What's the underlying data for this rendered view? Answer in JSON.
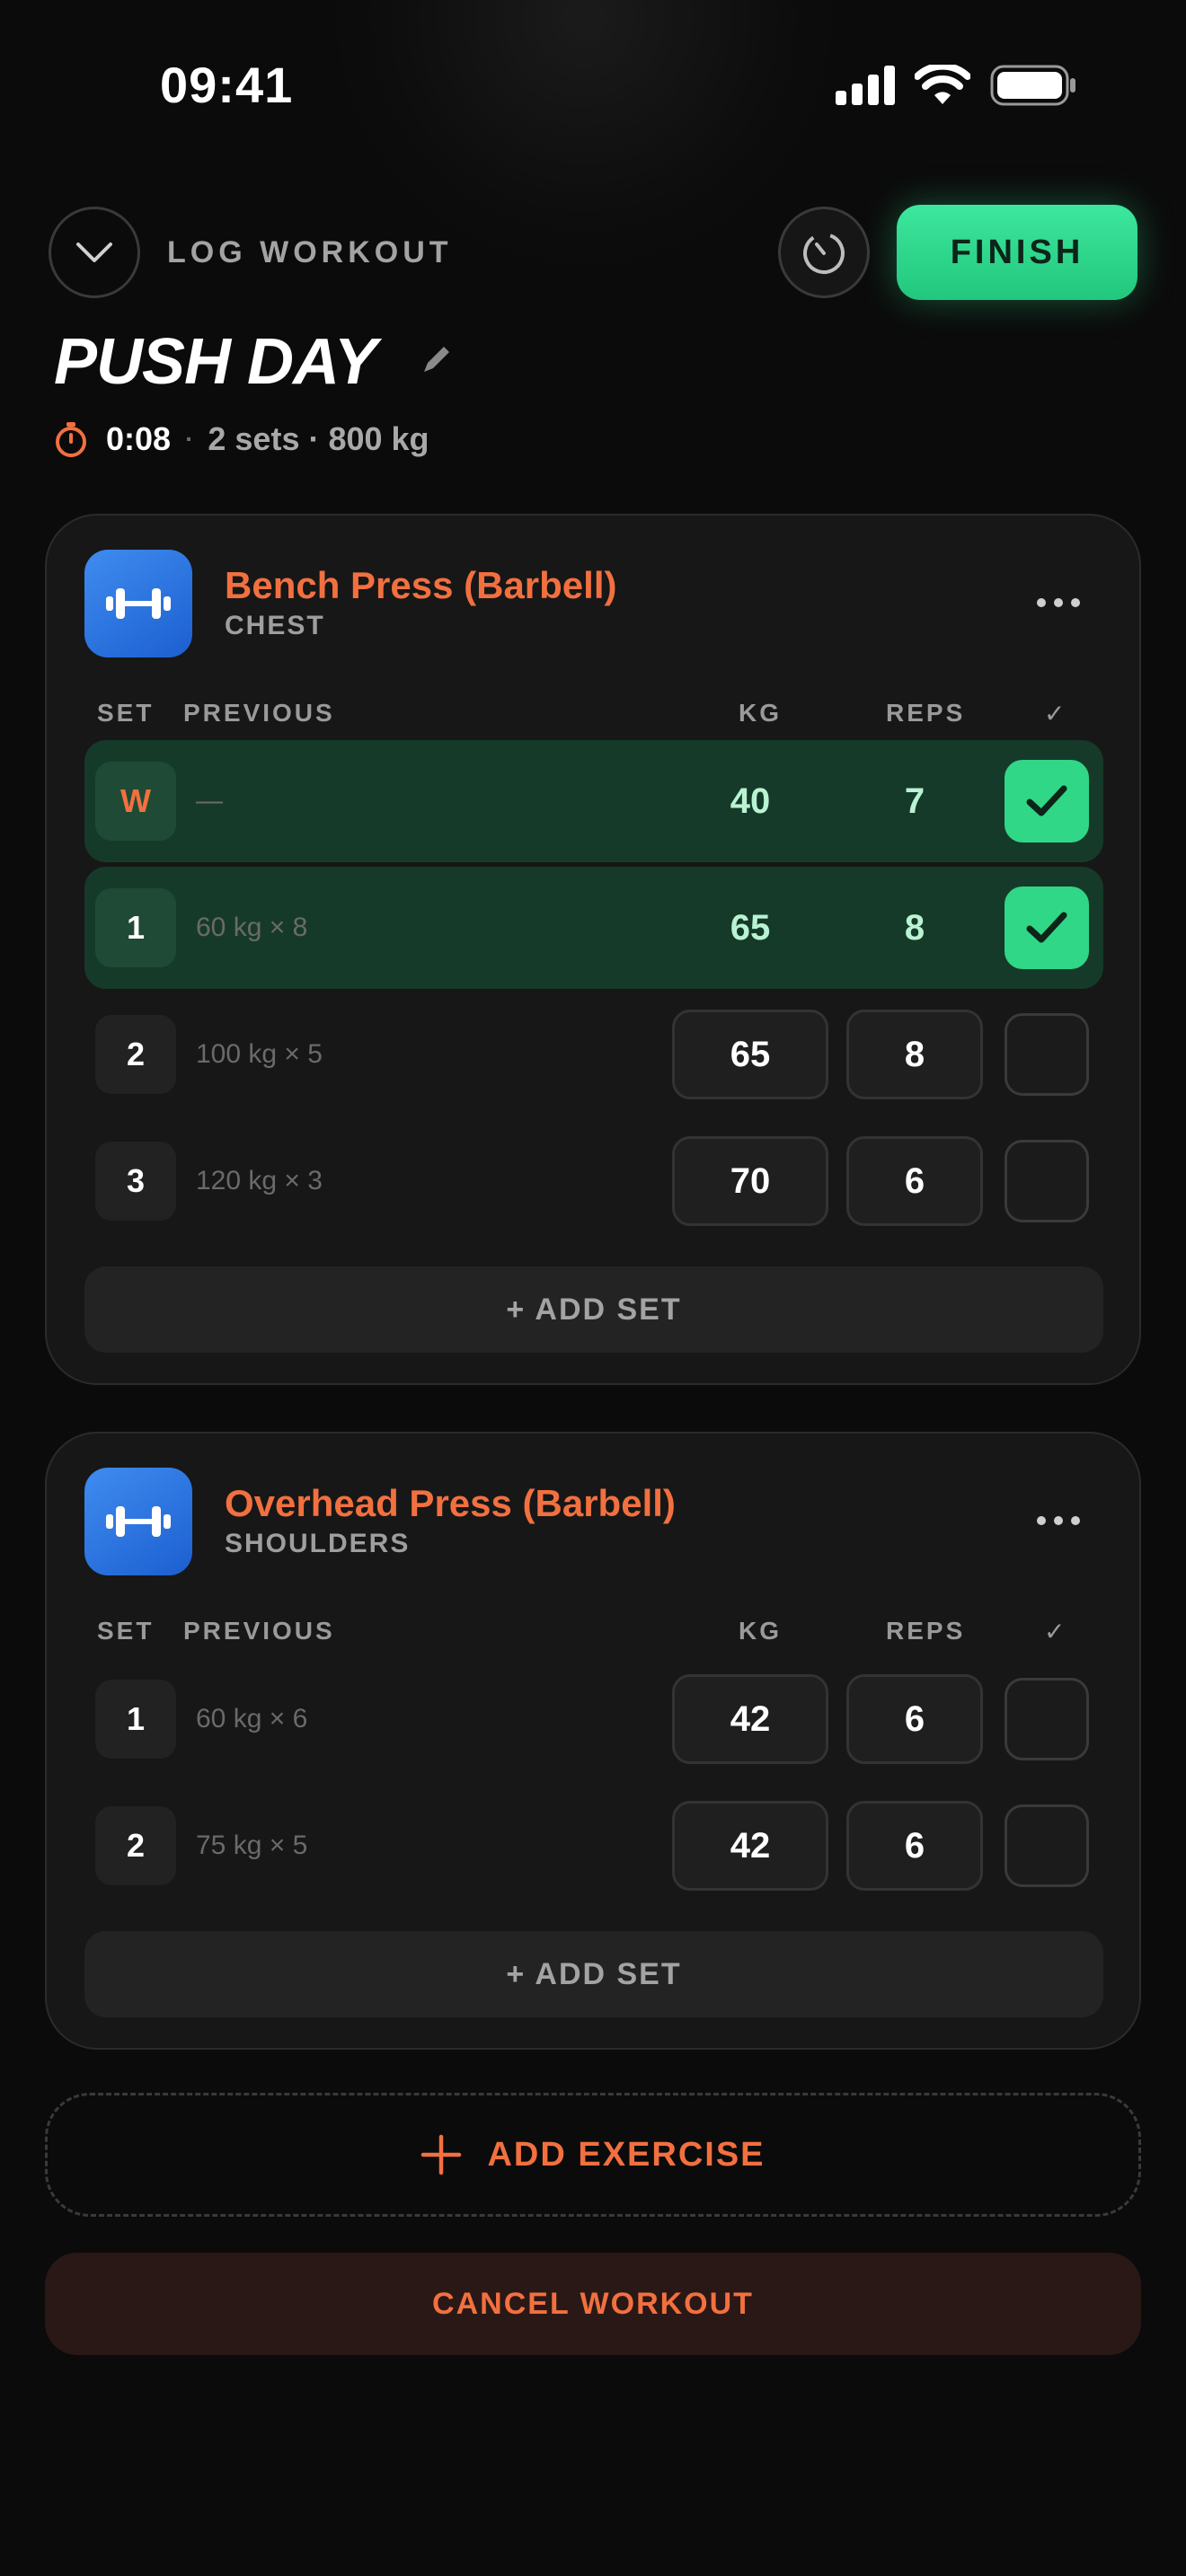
{
  "status_bar": {
    "time": "09:41",
    "signal_icon": "cellular-signal-icon",
    "wifi_icon": "wifi-icon",
    "battery_icon": "battery-icon"
  },
  "header": {
    "collapse_icon": "chevron-down-icon",
    "title": "LOG WORKOUT",
    "timer_icon": "rest-timer-icon",
    "finish_label": "FINISH"
  },
  "workout": {
    "name": "PUSH DAY",
    "edit_icon": "pencil-icon",
    "elapsed_icon": "stopwatch-icon",
    "elapsed": "0:08",
    "separator": "·",
    "summary": "2 sets · 800 kg"
  },
  "exercises": [
    {
      "name": "Bench Press (Barbell)",
      "muscle": "CHEST",
      "icon": "dumbbell-icon",
      "columns": {
        "set": "SET",
        "previous": "PREVIOUS",
        "kg": "KG",
        "reps": "REPS",
        "done": "✓"
      },
      "sets": [
        {
          "set": "W",
          "previous": "—",
          "kg": "40",
          "reps": "7",
          "completed": true,
          "warmup": true
        },
        {
          "set": "1",
          "previous": "60 kg × 8",
          "kg": "65",
          "reps": "8",
          "completed": true
        },
        {
          "set": "2",
          "previous": "100 kg × 5",
          "kg": "65",
          "reps": "8",
          "completed": false
        },
        {
          "set": "3",
          "previous": "120 kg × 3",
          "kg": "70",
          "reps": "6",
          "completed": false
        }
      ],
      "add_set_label": "+ ADD SET"
    },
    {
      "name": "Overhead Press (Barbell)",
      "muscle": "SHOULDERS",
      "icon": "dumbbell-icon",
      "columns": {
        "set": "SET",
        "previous": "PREVIOUS",
        "kg": "KG",
        "reps": "REPS",
        "done": "✓"
      },
      "sets": [
        {
          "set": "1",
          "previous": "60 kg × 6",
          "kg": "42",
          "reps": "6",
          "completed": false
        },
        {
          "set": "2",
          "previous": "75 kg × 5",
          "kg": "42",
          "reps": "6",
          "completed": false
        }
      ],
      "add_set_label": "+ ADD SET"
    }
  ],
  "actions": {
    "add_exercise_label": "ADD EXERCISE",
    "add_exercise_icon": "plus-icon",
    "cancel_label": "CANCEL WORKOUT"
  },
  "colors": {
    "accent": "#f2703f",
    "success": "#2fd786",
    "background": "#0b0b0b",
    "card": "#171717"
  }
}
